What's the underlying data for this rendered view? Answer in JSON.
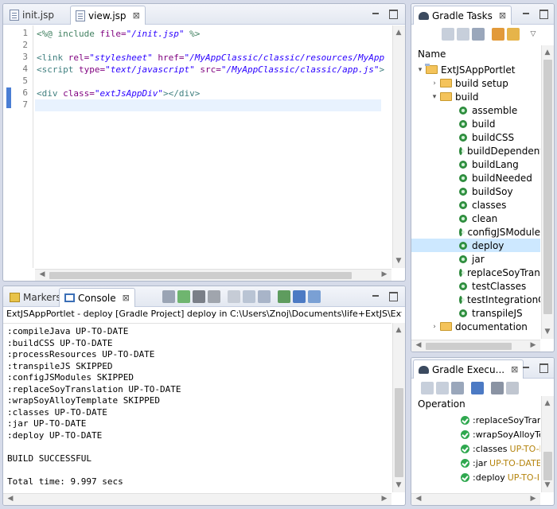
{
  "editor": {
    "tabs": [
      {
        "label": "init.jsp",
        "active": false
      },
      {
        "label": "view.jsp",
        "active": true
      }
    ],
    "close_glyph": "⊠",
    "line_numbers": [
      "1",
      "2",
      "3",
      "4",
      "5",
      "6",
      "7"
    ],
    "lines": [
      [
        {
          "t": "<%@ include ",
          "c": "dir"
        },
        {
          "t": "file=",
          "c": "attr"
        },
        {
          "t": "\"/init.jsp\"",
          "c": "str"
        },
        {
          "t": " %>",
          "c": "dir"
        }
      ],
      [],
      [
        {
          "t": "<link ",
          "c": "tag"
        },
        {
          "t": "rel=",
          "c": "attr"
        },
        {
          "t": "\"stylesheet\"",
          "c": "str"
        },
        {
          "t": " href=",
          "c": "attr"
        },
        {
          "t": "\"/MyAppClassic/classic/resources/MyApp",
          "c": "str"
        }
      ],
      [
        {
          "t": "<script ",
          "c": "tag"
        },
        {
          "t": "type=",
          "c": "attr"
        },
        {
          "t": "\"text/javascript\"",
          "c": "str"
        },
        {
          "t": " src=",
          "c": "attr"
        },
        {
          "t": "\"/MyAppClassic/classic/app.js\"",
          "c": "str"
        },
        {
          "t": ">",
          "c": "tag"
        }
      ],
      [],
      [
        {
          "t": "<div ",
          "c": "tag"
        },
        {
          "t": "class=",
          "c": "attr"
        },
        {
          "t": "\"extJsAppDiv\"",
          "c": "str"
        },
        {
          "t": "></div>",
          "c": "tag"
        }
      ],
      []
    ]
  },
  "console": {
    "tabs": [
      {
        "label": "Markers",
        "active": false
      },
      {
        "label": "Console",
        "active": true
      }
    ],
    "description": "ExtJSAppPortlet - deploy [Gradle Project] deploy in C:\\Users\\Znoj\\Documents\\life+ExtJS\\ExtJSAppPo",
    "output": [
      ":compileJava UP-TO-DATE",
      ":buildCSS UP-TO-DATE",
      ":processResources UP-TO-DATE",
      ":transpileJS SKIPPED",
      ":configJSModules SKIPPED",
      ":replaceSoyTranslation UP-TO-DATE",
      ":wrapSoyAlloyTemplate SKIPPED",
      ":classes UP-TO-DATE",
      ":jar UP-TO-DATE",
      ":deploy UP-TO-DATE",
      "",
      "BUILD SUCCESSFUL",
      "",
      "Total time: 9.997 secs"
    ]
  },
  "gradle_tasks": {
    "title": "Gradle Tasks",
    "column_header": "Name",
    "project": "ExtJSAppPortlet",
    "groups": [
      {
        "label": "build setup",
        "expanded": false
      },
      {
        "label": "build",
        "expanded": true
      },
      {
        "label": "documentation",
        "expanded": false
      }
    ],
    "build_tasks": [
      "assemble",
      "build",
      "buildCSS",
      "buildDependent",
      "buildLang",
      "buildNeeded",
      "buildSoy",
      "classes",
      "clean",
      "configJSModule",
      "deploy",
      "jar",
      "replaceSoyTrans",
      "testClasses",
      "testIntegrationC",
      "transpileJS"
    ],
    "selected": "deploy"
  },
  "gradle_exec": {
    "title": "Gradle Execu...",
    "column_header": "Operation",
    "rows": [
      {
        "op": ":replaceSoyTrans",
        "status": ""
      },
      {
        "op": ":wrapSoyAlloyTe",
        "status": ""
      },
      {
        "op": ":classes",
        "status": "UP-TO-I"
      },
      {
        "op": ":jar",
        "status": "UP-TO-DATE"
      },
      {
        "op": ":deploy",
        "status": "UP-TO-I"
      }
    ]
  },
  "colors": {
    "background": "#d6dbe9",
    "selection": "#cde8ff",
    "current_line": "#e8f2fe",
    "success": "#2fa84f",
    "status_text": "#b5850f"
  }
}
